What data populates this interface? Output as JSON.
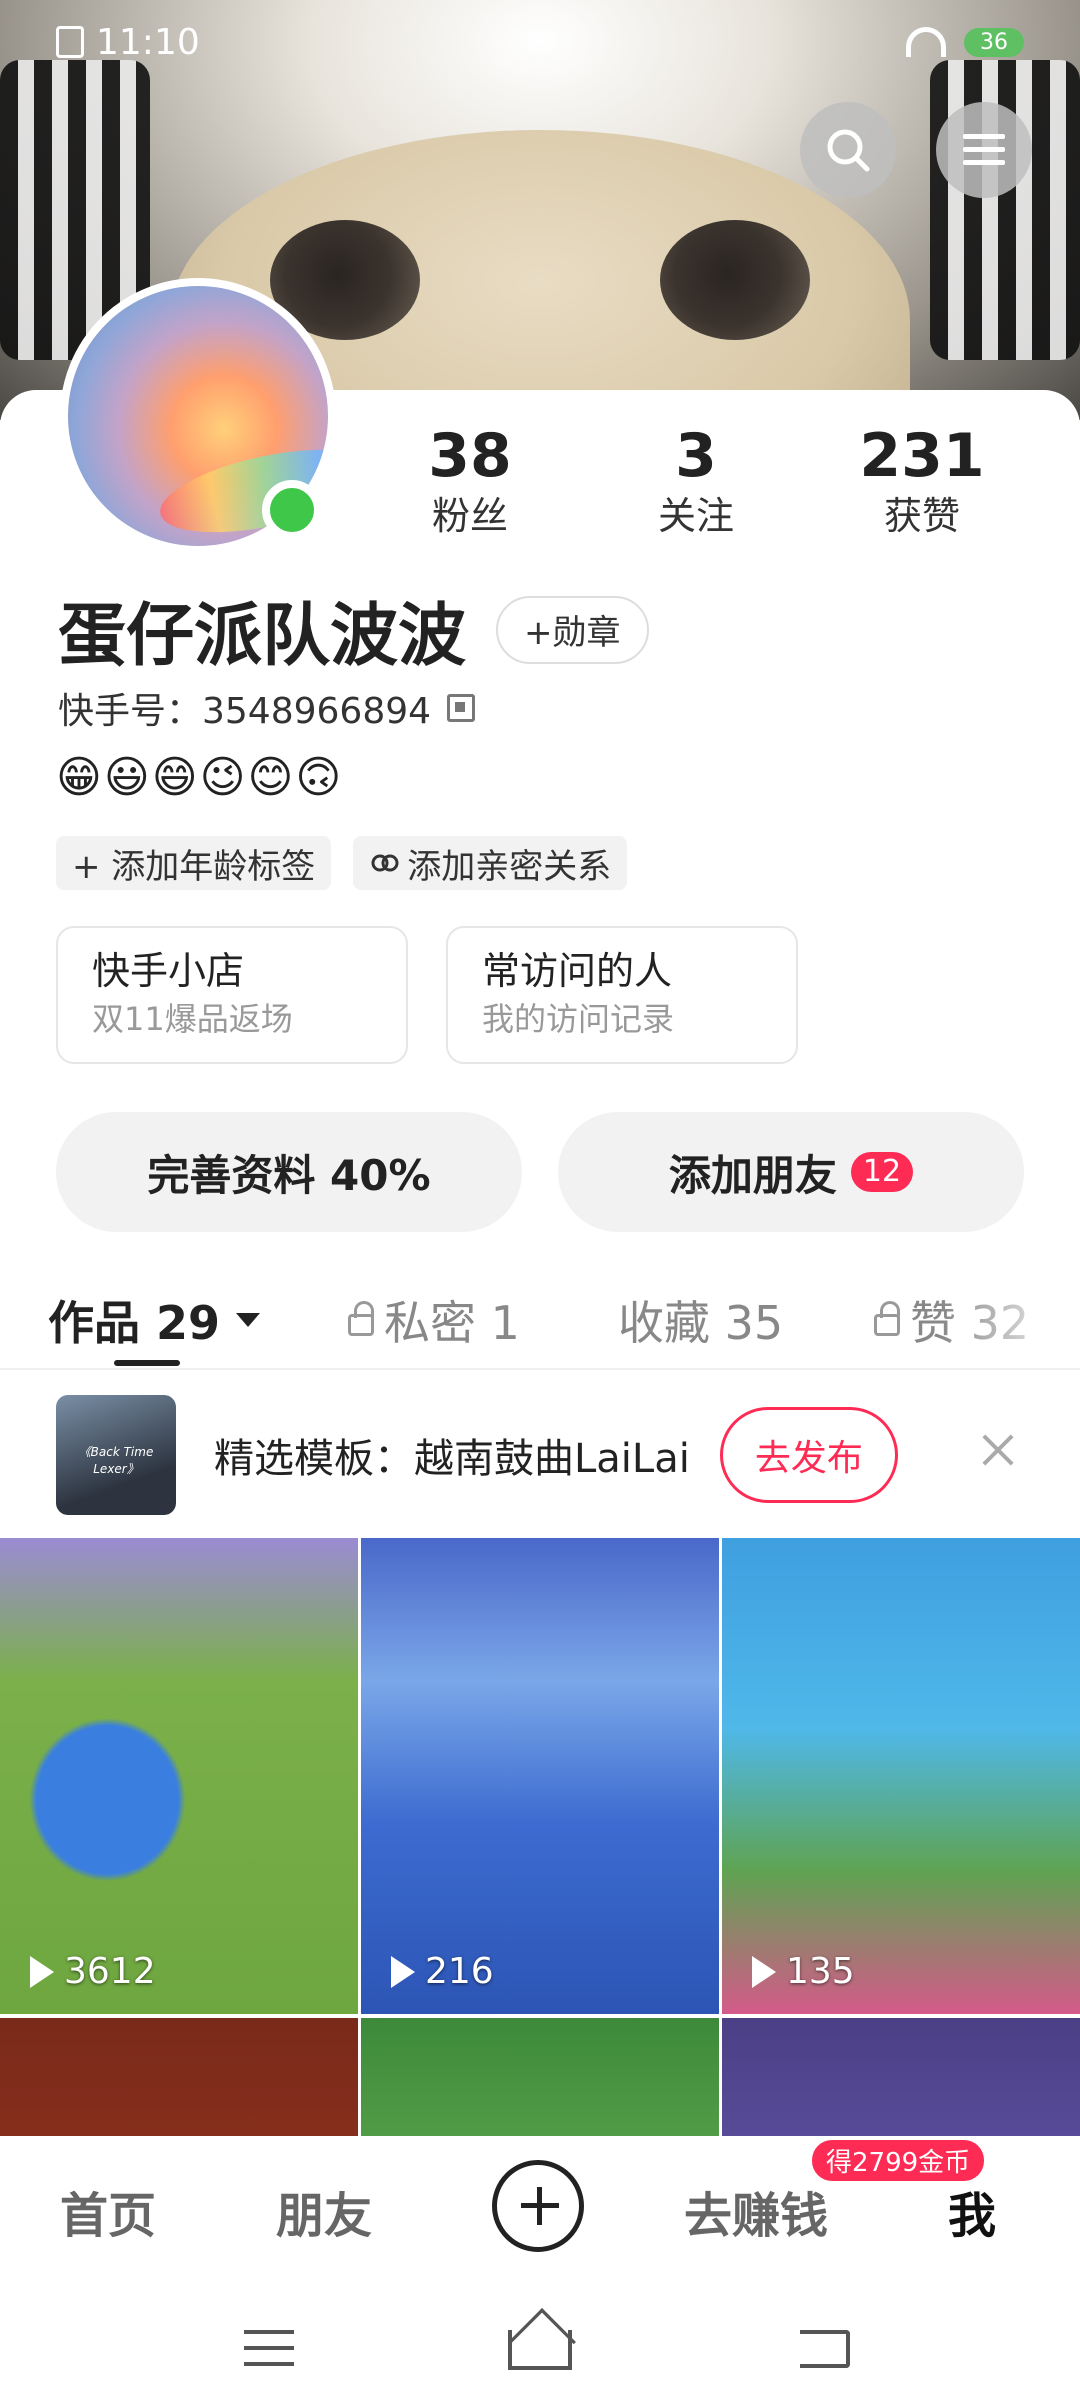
{
  "status_bar": {
    "time": "11:10",
    "battery": "36"
  },
  "profile": {
    "nickname": "蛋仔派队波波",
    "medal_button": "+勋章",
    "kuaishou_id": "快手号：3548966894",
    "emojis": "😁😃😄😉😊🙃",
    "stats": [
      {
        "value": "38",
        "label": "粉丝"
      },
      {
        "value": "3",
        "label": "关注"
      },
      {
        "value": "231",
        "label": "获赞"
      }
    ],
    "tags": [
      {
        "label": "+ 添加年龄标签"
      },
      {
        "label": "添加亲密关系"
      }
    ],
    "cards": [
      {
        "title": "快手小店",
        "subtitle": "双11爆品返场"
      },
      {
        "title": "常访问的人",
        "subtitle": "我的访问记录"
      }
    ],
    "actions": {
      "complete_profile": "完善资料 40%",
      "add_friends": "添加朋友",
      "add_friends_badge": "12"
    }
  },
  "tabs": [
    {
      "label": "作品 29"
    },
    {
      "label": "私密 1"
    },
    {
      "label": "收藏 35"
    },
    {
      "label": "赞 32"
    }
  ],
  "template": {
    "thumb_text": "《Back Time Lexer》",
    "text": "精选模板：越南鼓曲LaiLai",
    "publish_button": "去发布"
  },
  "videos": [
    {
      "plays": "3612"
    },
    {
      "plays": "216"
    },
    {
      "plays": "135"
    }
  ],
  "bottom_nav": {
    "home": "首页",
    "friends": "朋友",
    "earn": "去赚钱",
    "earn_badge": "得2799金币",
    "me": "我"
  }
}
